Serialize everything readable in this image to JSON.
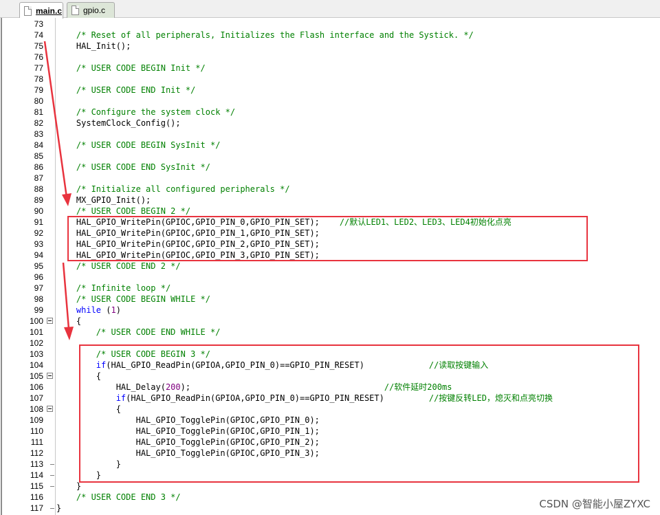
{
  "tabs": [
    {
      "label": "main.c",
      "active": true
    },
    {
      "label": "gpio.c",
      "active": false
    }
  ],
  "lines": [
    {
      "num": "73",
      "fold": "",
      "segs": []
    },
    {
      "num": "74",
      "fold": "",
      "segs": [
        {
          "t": "    "
        },
        {
          "t": "/* Reset of all peripherals, Initializes the Flash interface and the Systick. */",
          "c": "cmt"
        }
      ]
    },
    {
      "num": "75",
      "fold": "",
      "segs": [
        {
          "t": "    HAL_Init();"
        }
      ]
    },
    {
      "num": "76",
      "fold": "",
      "segs": []
    },
    {
      "num": "77",
      "fold": "",
      "segs": [
        {
          "t": "    "
        },
        {
          "t": "/* USER CODE BEGIN Init */",
          "c": "cmt"
        }
      ]
    },
    {
      "num": "78",
      "fold": "",
      "segs": []
    },
    {
      "num": "79",
      "fold": "",
      "segs": [
        {
          "t": "    "
        },
        {
          "t": "/* USER CODE END Init */",
          "c": "cmt"
        }
      ]
    },
    {
      "num": "80",
      "fold": "",
      "segs": []
    },
    {
      "num": "81",
      "fold": "",
      "segs": [
        {
          "t": "    "
        },
        {
          "t": "/* Configure the system clock */",
          "c": "cmt"
        }
      ]
    },
    {
      "num": "82",
      "fold": "",
      "segs": [
        {
          "t": "    SystemClock_Config();"
        }
      ]
    },
    {
      "num": "83",
      "fold": "",
      "segs": []
    },
    {
      "num": "84",
      "fold": "",
      "segs": [
        {
          "t": "    "
        },
        {
          "t": "/* USER CODE BEGIN SysInit */",
          "c": "cmt"
        }
      ]
    },
    {
      "num": "85",
      "fold": "",
      "segs": []
    },
    {
      "num": "86",
      "fold": "",
      "segs": [
        {
          "t": "    "
        },
        {
          "t": "/* USER CODE END SysInit */",
          "c": "cmt"
        }
      ]
    },
    {
      "num": "87",
      "fold": "",
      "segs": []
    },
    {
      "num": "88",
      "fold": "",
      "segs": [
        {
          "t": "    "
        },
        {
          "t": "/* Initialize all configured peripherals */",
          "c": "cmt"
        }
      ]
    },
    {
      "num": "89",
      "fold": "",
      "segs": [
        {
          "t": "    MX_GPIO_Init();"
        }
      ]
    },
    {
      "num": "90",
      "fold": "",
      "segs": [
        {
          "t": "    "
        },
        {
          "t": "/* USER CODE BEGIN 2 */",
          "c": "cmt"
        }
      ]
    },
    {
      "num": "91",
      "fold": "",
      "segs": [
        {
          "t": "    HAL_GPIO_WritePin(GPIOC,GPIO_PIN_0,GPIO_PIN_SET);    "
        },
        {
          "t": "//默认LED1、LED2、LED3、LED4初始化点亮",
          "c": "cmt"
        }
      ]
    },
    {
      "num": "92",
      "fold": "",
      "segs": [
        {
          "t": "    HAL_GPIO_WritePin(GPIOC,GPIO_PIN_1,GPIO_PIN_SET);"
        }
      ]
    },
    {
      "num": "93",
      "fold": "",
      "segs": [
        {
          "t": "    HAL_GPIO_WritePin(GPIOC,GPIO_PIN_2,GPIO_PIN_SET);"
        }
      ]
    },
    {
      "num": "94",
      "fold": "",
      "segs": [
        {
          "t": "    HAL_GPIO_WritePin(GPIOC,GPIO_PIN_3,GPIO_PIN_SET);"
        }
      ]
    },
    {
      "num": "95",
      "fold": "",
      "segs": [
        {
          "t": "    "
        },
        {
          "t": "/* USER CODE END 2 */",
          "c": "cmt"
        }
      ]
    },
    {
      "num": "96",
      "fold": "",
      "segs": []
    },
    {
      "num": "97",
      "fold": "",
      "segs": [
        {
          "t": "    "
        },
        {
          "t": "/* Infinite loop */",
          "c": "cmt"
        }
      ]
    },
    {
      "num": "98",
      "fold": "",
      "segs": [
        {
          "t": "    "
        },
        {
          "t": "/* USER CODE BEGIN WHILE */",
          "c": "cmt"
        }
      ]
    },
    {
      "num": "99",
      "fold": "",
      "segs": [
        {
          "t": "    "
        },
        {
          "t": "while",
          "c": "kw"
        },
        {
          "t": " ("
        },
        {
          "t": "1",
          "c": "num"
        },
        {
          "t": ")"
        }
      ]
    },
    {
      "num": "100",
      "fold": "box",
      "segs": [
        {
          "t": "    {"
        }
      ]
    },
    {
      "num": "101",
      "fold": "",
      "segs": [
        {
          "t": "        "
        },
        {
          "t": "/* USER CODE END WHILE */",
          "c": "cmt"
        }
      ]
    },
    {
      "num": "102",
      "fold": "",
      "segs": []
    },
    {
      "num": "103",
      "fold": "",
      "segs": [
        {
          "t": "        "
        },
        {
          "t": "/* USER CODE BEGIN 3 */",
          "c": "cmt"
        }
      ]
    },
    {
      "num": "104",
      "fold": "",
      "segs": [
        {
          "t": "        "
        },
        {
          "t": "if",
          "c": "kw"
        },
        {
          "t": "(HAL_GPIO_ReadPin(GPIOA,GPIO_PIN_0)==GPIO_PIN_RESET)             "
        },
        {
          "t": "//读取按键输入",
          "c": "cmt"
        }
      ]
    },
    {
      "num": "105",
      "fold": "box",
      "segs": [
        {
          "t": "        {"
        }
      ]
    },
    {
      "num": "106",
      "fold": "",
      "segs": [
        {
          "t": "            HAL_Delay("
        },
        {
          "t": "200",
          "c": "num"
        },
        {
          "t": ");                                       "
        },
        {
          "t": "//软件延时200ms",
          "c": "cmt"
        }
      ]
    },
    {
      "num": "107",
      "fold": "",
      "segs": [
        {
          "t": "            "
        },
        {
          "t": "if",
          "c": "kw"
        },
        {
          "t": "(HAL_GPIO_ReadPin(GPIOA,GPIO_PIN_0)==GPIO_PIN_RESET)         "
        },
        {
          "t": "//按键反转LED，熄灭和点亮切换",
          "c": "cmt"
        }
      ]
    },
    {
      "num": "108",
      "fold": "box",
      "segs": [
        {
          "t": "            {"
        }
      ]
    },
    {
      "num": "109",
      "fold": "",
      "segs": [
        {
          "t": "                HAL_GPIO_TogglePin(GPIOC,GPIO_PIN_0);"
        }
      ]
    },
    {
      "num": "110",
      "fold": "",
      "segs": [
        {
          "t": "                HAL_GPIO_TogglePin(GPIOC,GPIO_PIN_1);"
        }
      ]
    },
    {
      "num": "111",
      "fold": "",
      "segs": [
        {
          "t": "                HAL_GPIO_TogglePin(GPIOC,GPIO_PIN_2);"
        }
      ]
    },
    {
      "num": "112",
      "fold": "",
      "segs": [
        {
          "t": "                HAL_GPIO_TogglePin(GPIOC,GPIO_PIN_3);"
        }
      ]
    },
    {
      "num": "113",
      "fold": "tick",
      "segs": [
        {
          "t": "            }"
        }
      ]
    },
    {
      "num": "114",
      "fold": "tick",
      "segs": [
        {
          "t": "        }"
        }
      ]
    },
    {
      "num": "115",
      "fold": "tick",
      "segs": [
        {
          "t": "    }"
        }
      ]
    },
    {
      "num": "116",
      "fold": "",
      "segs": [
        {
          "t": "    "
        },
        {
          "t": "/* USER CODE END 3 */",
          "c": "cmt"
        }
      ]
    },
    {
      "num": "117",
      "fold": "tick",
      "segs": [
        {
          "t": "}"
        }
      ]
    }
  ],
  "syntax_colors": {
    "comment": "#008000",
    "keyword": "#0000ff",
    "number": "#800080",
    "text": "#000000"
  },
  "highlight_color": "#e8333e",
  "watermark": "CSDN @智能小屋ZYXC"
}
